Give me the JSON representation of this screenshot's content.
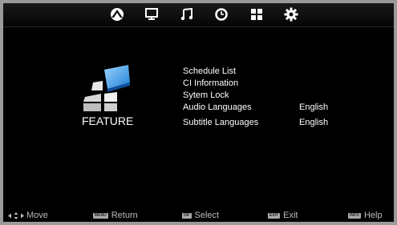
{
  "topbar": {
    "icons": [
      "picture-icon",
      "channel-icon",
      "sound-icon",
      "time-icon",
      "feature-icon",
      "setup-icon"
    ]
  },
  "section": {
    "title": "FEATURE"
  },
  "menu": {
    "items": [
      {
        "label": "Schedule List",
        "value": ""
      },
      {
        "label": "CI Information",
        "value": ""
      },
      {
        "label": "Sytem Lock",
        "value": ""
      },
      {
        "label": "Audio Languages",
        "value": "English"
      },
      {
        "label": "Subtitle Languages",
        "value": "English"
      }
    ]
  },
  "help": {
    "move": {
      "key": "",
      "label": "Move"
    },
    "return": {
      "key": "MENU",
      "label": "Return"
    },
    "select": {
      "key": "OK",
      "label": "Select"
    },
    "exit": {
      "key": "EXIT",
      "label": "Exit"
    },
    "help": {
      "key": "INFO",
      "label": "Help"
    }
  }
}
